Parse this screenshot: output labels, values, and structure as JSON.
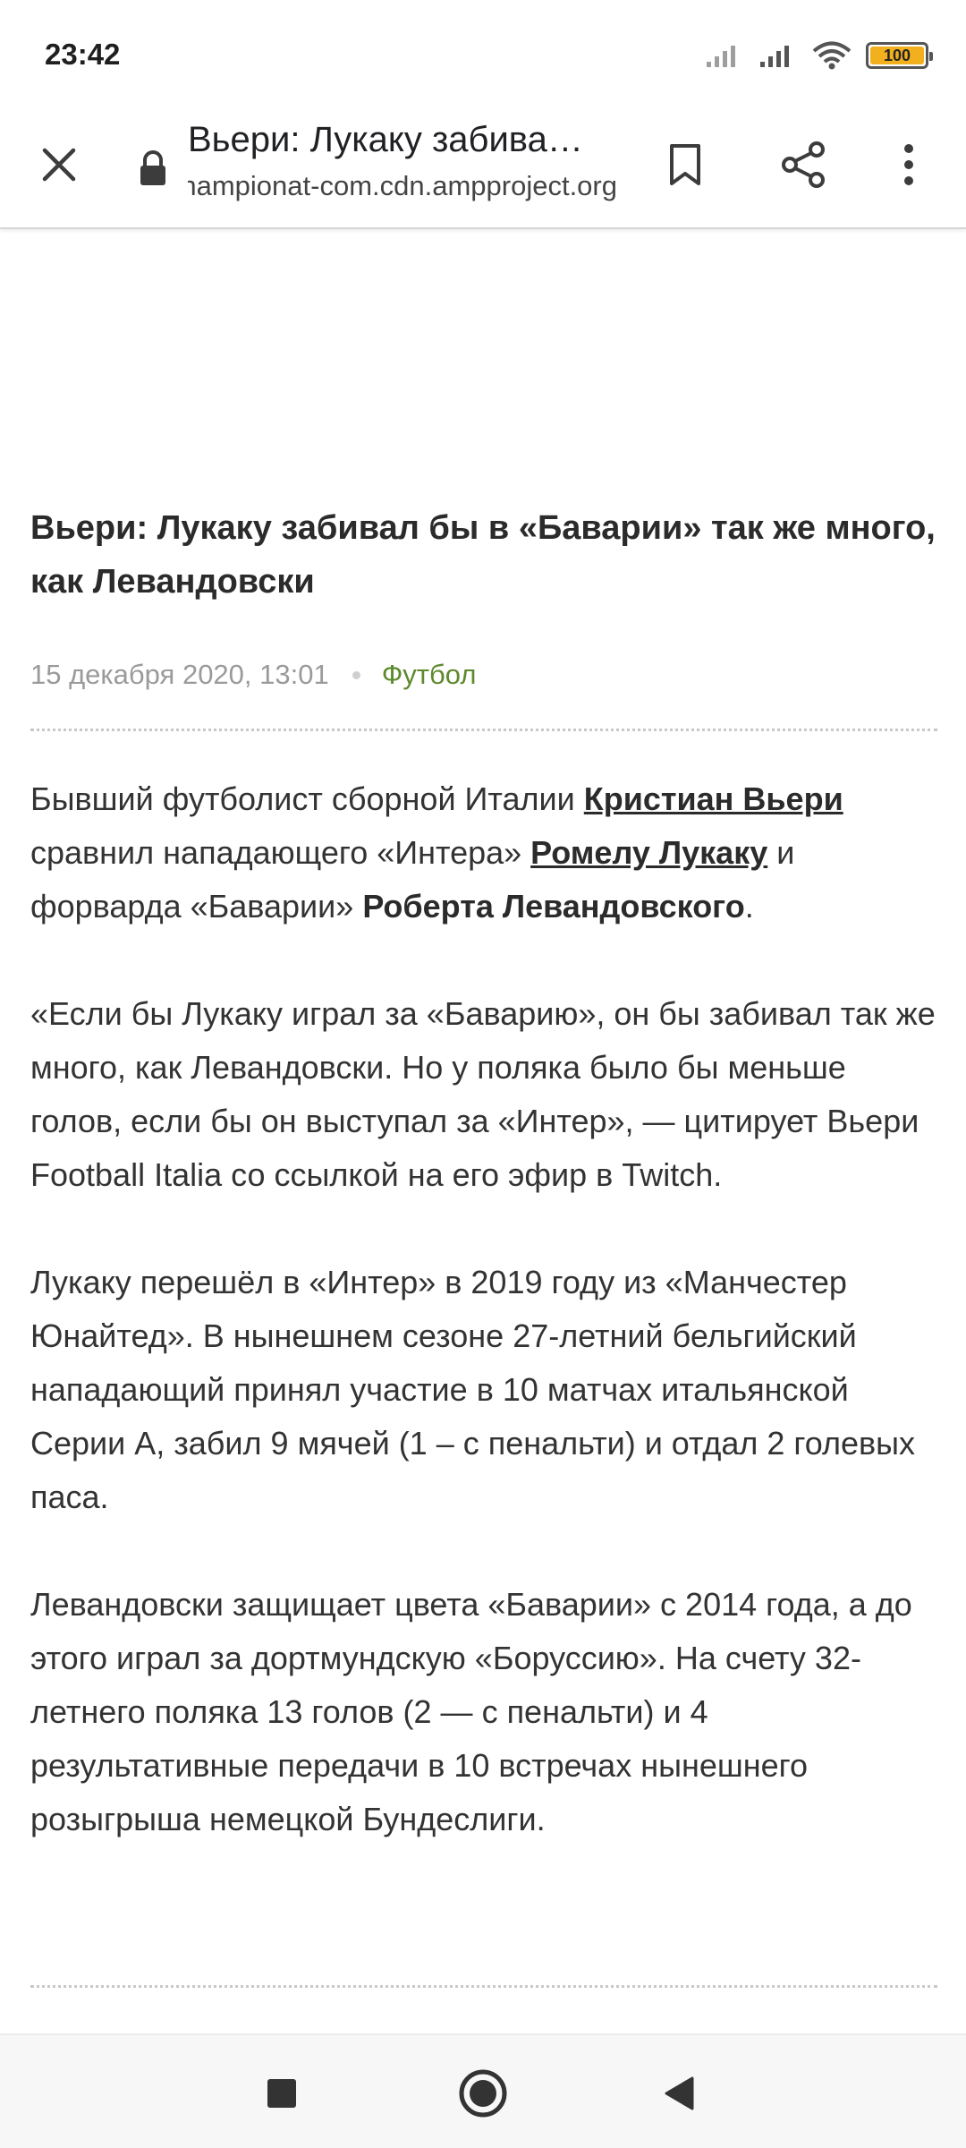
{
  "status_bar": {
    "time": "23:42",
    "battery": "100",
    "battery_level": 1.0,
    "icons": [
      "signal-icon",
      "signal-icon",
      "wifi-icon",
      "battery-icon"
    ]
  },
  "toolbar": {
    "title": "Вьери: Лукаку забивал бы в «Баварии» так же много, как Левандовски",
    "url": "https://championat-com.cdn.ampproject.org"
  },
  "article": {
    "headline": "Вьери: Лукаку забивал бы в «Баварии» так же много, как Левандовски",
    "date": "15 декабря 2020, 13:01",
    "category": "Футбол",
    "p1": {
      "a": "Бывший футболист сборной Италии ",
      "link1": "Кристиан Вьери",
      "b": " сравнил нападающего «Интера» ",
      "link2": "Ромелу Лукаку",
      "c": " и форварда «Баварии» ",
      "bold": "Роберта Левандовского",
      "d": "."
    },
    "p2": "«Если бы Лукаку играл за «Баварию», он бы забивал так же много, как Левандовски. Но у поляка было бы меньше голов, если бы он выступал за «Интер», — цитирует Вьери Football Italia со ссылкой на его эфир в Twitch.",
    "p3": "Лукаку перешёл в «Интер» в 2019 году из «Манчестер Юнайтед». В нынешнем сезоне 27-летний бельгийский нападающий принял участие в 10 матчах итальянской Серии А, забил 9 мячей (1 – с пенальти) и отдал 2 голевых паса.",
    "p4": "Левандовски защищает цвета «Баварии» с 2014 года, а до этого играл за дортмундскую «Боруссию». На счету 32-летнего поляка 13 голов (2 — с пенальти) и 4 результативные передачи в 10 встречах нынешнего розыгрыша немецкой Бундеслиги."
  },
  "colors": {
    "category": "#5e8a2e",
    "battery_fill": "#f2b01e"
  }
}
